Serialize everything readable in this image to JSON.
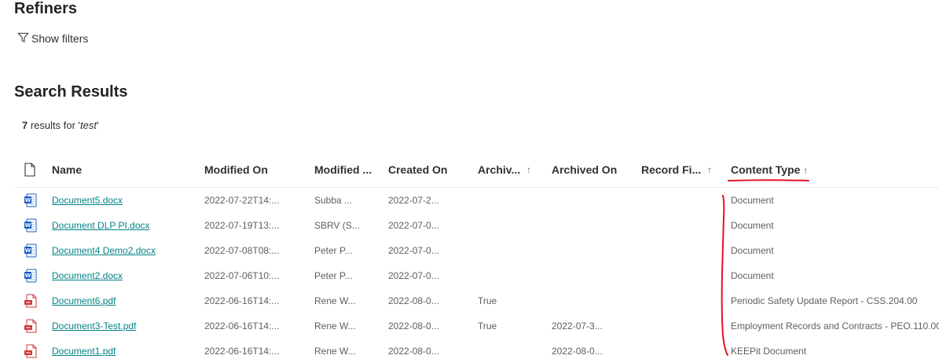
{
  "refiners": {
    "title": "Refiners",
    "show_filters_label": "Show filters"
  },
  "search_results": {
    "title": "Search Results",
    "count": "7",
    "count_text_prefix": " results for '",
    "query": "test",
    "count_text_suffix": "'"
  },
  "table": {
    "columns": {
      "name": "Name",
      "modified_on": "Modified On",
      "modified_by": "Modified ...",
      "created_on": "Created On",
      "archived": "Archiv...",
      "archived_on": "Archived On",
      "record_fi": "Record Fi...",
      "content_type": "Content Type"
    },
    "sort_glyph": "↑",
    "rows": [
      {
        "icon": "word-doc-icon",
        "name": "Document5.docx",
        "modified_on": "2022-07-22T14:...",
        "modified_by": "Subba ...",
        "created_on": "2022-07-2...",
        "archived": "",
        "archived_on": "",
        "record_fi": "",
        "content_type": "Document"
      },
      {
        "icon": "word-doc-icon",
        "name": "Document DLP PI.docx",
        "modified_on": "2022-07-19T13:...",
        "modified_by": "SBRV (S...",
        "created_on": "2022-07-0...",
        "archived": "",
        "archived_on": "",
        "record_fi": "",
        "content_type": "Document"
      },
      {
        "icon": "word-doc-icon",
        "name": "Document4 Demo2.docx",
        "modified_on": "2022-07-08T08:...",
        "modified_by": "Peter P...",
        "created_on": "2022-07-0...",
        "archived": "",
        "archived_on": "",
        "record_fi": "",
        "content_type": "Document"
      },
      {
        "icon": "word-doc-icon",
        "name": "Document2.docx",
        "modified_on": "2022-07-06T10:...",
        "modified_by": "Peter P...",
        "created_on": "2022-07-0...",
        "archived": "",
        "archived_on": "",
        "record_fi": "",
        "content_type": "Document"
      },
      {
        "icon": "pdf-doc-icon",
        "name": "Document6.pdf",
        "modified_on": "2022-06-16T14:...",
        "modified_by": "Rene W...",
        "created_on": "2022-08-0...",
        "archived": "True",
        "archived_on": "",
        "record_fi": "",
        "content_type": "Periodic Safety Update Report - CSS.204.00"
      },
      {
        "icon": "pdf-doc-icon",
        "name": "Document3-Test.pdf",
        "modified_on": "2022-06-16T14:...",
        "modified_by": "Rene W...",
        "created_on": "2022-08-0...",
        "archived": "True",
        "archived_on": "2022-07-3...",
        "record_fi": "",
        "content_type": "Employment Records and Contracts - PEO.110.00"
      },
      {
        "icon": "pdf-doc-icon",
        "name": "Document1.pdf",
        "modified_on": "2022-06-16T14:...",
        "modified_by": "Rene W...",
        "created_on": "2022-08-0...",
        "archived": "",
        "archived_on": "2022-08-0...",
        "record_fi": "",
        "content_type": "KEEPit Document"
      }
    ]
  },
  "colors": {
    "link": "#038387",
    "word_blue": "#185abd",
    "pdf_red": "#d13438",
    "annotation_red": "#e81123"
  }
}
